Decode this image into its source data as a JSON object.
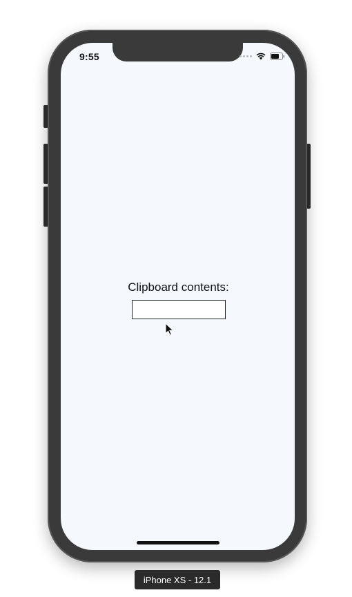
{
  "status_bar": {
    "time": "9:55"
  },
  "main": {
    "label": "Clipboard contents:",
    "input_value": "",
    "input_placeholder": ""
  },
  "device_badge": {
    "text": "iPhone XS - 12.1"
  },
  "icons": {
    "signal": "signal-icon",
    "wifi": "wifi-icon",
    "battery": "battery-icon",
    "cursor": "mouse-pointer-icon"
  }
}
